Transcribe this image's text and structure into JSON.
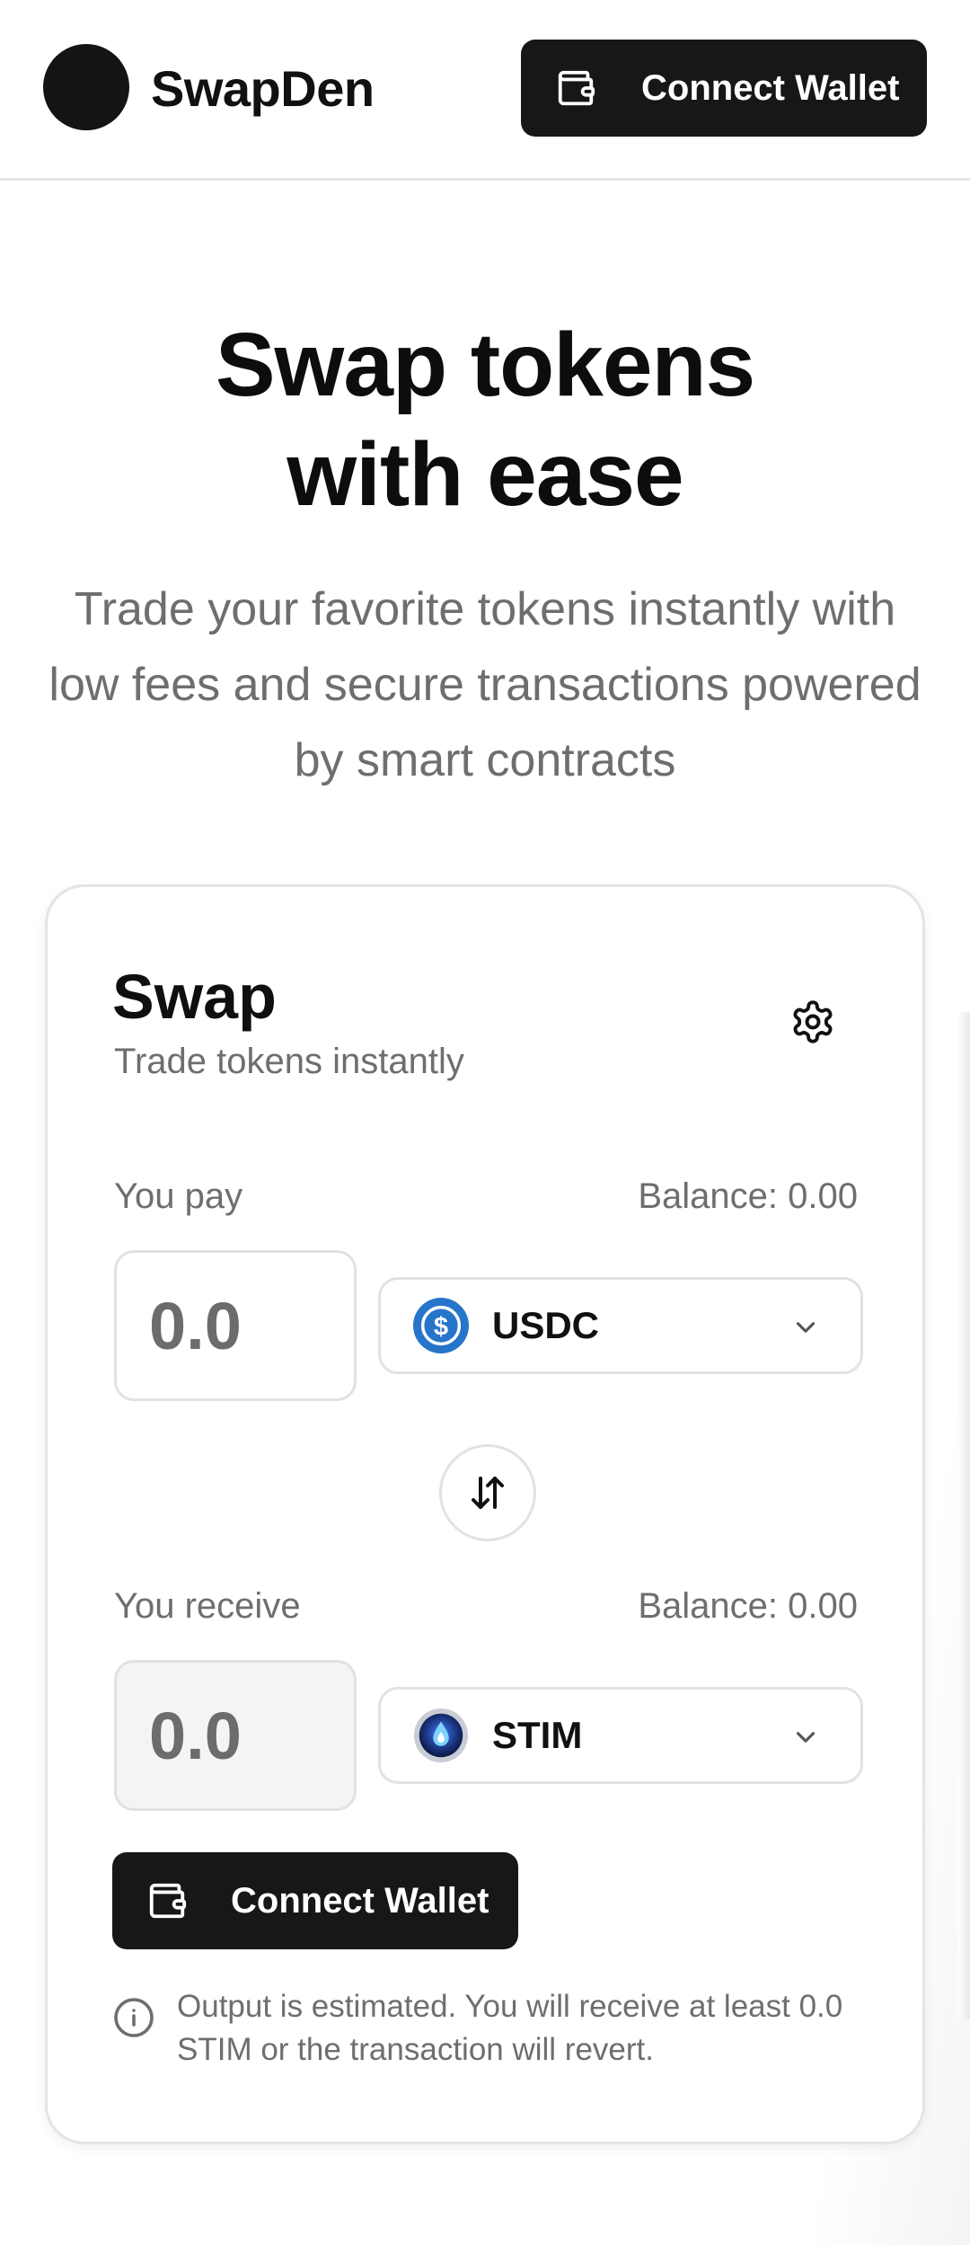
{
  "header": {
    "brand": "SwapDen",
    "connect_wallet": "Connect Wallet"
  },
  "hero": {
    "title_line1": "Swap tokens",
    "title_line2": "with ease",
    "subtitle": "Trade your favorite tokens instantly with low fees and secure transactions powered by smart contracts"
  },
  "card": {
    "title": "Swap",
    "subtitle": "Trade tokens instantly",
    "pay": {
      "label": "You pay",
      "balance": "Balance: 0.00",
      "amount_placeholder": "0.0",
      "token": "USDC",
      "token_icon": "usdc-icon"
    },
    "receive": {
      "label": "You receive",
      "balance": "Balance: 0.00",
      "amount": "0.0",
      "token": "STIM",
      "token_icon": "stim-icon"
    },
    "connect_wallet": "Connect Wallet",
    "info": "Output is estimated. You will receive at least 0.0 STIM or the transaction will revert."
  },
  "colors": {
    "primary_dark": "#171717",
    "muted_text": "#6e6e6e",
    "border": "#e2e2e2",
    "usdc_blue": "#2775ca"
  }
}
